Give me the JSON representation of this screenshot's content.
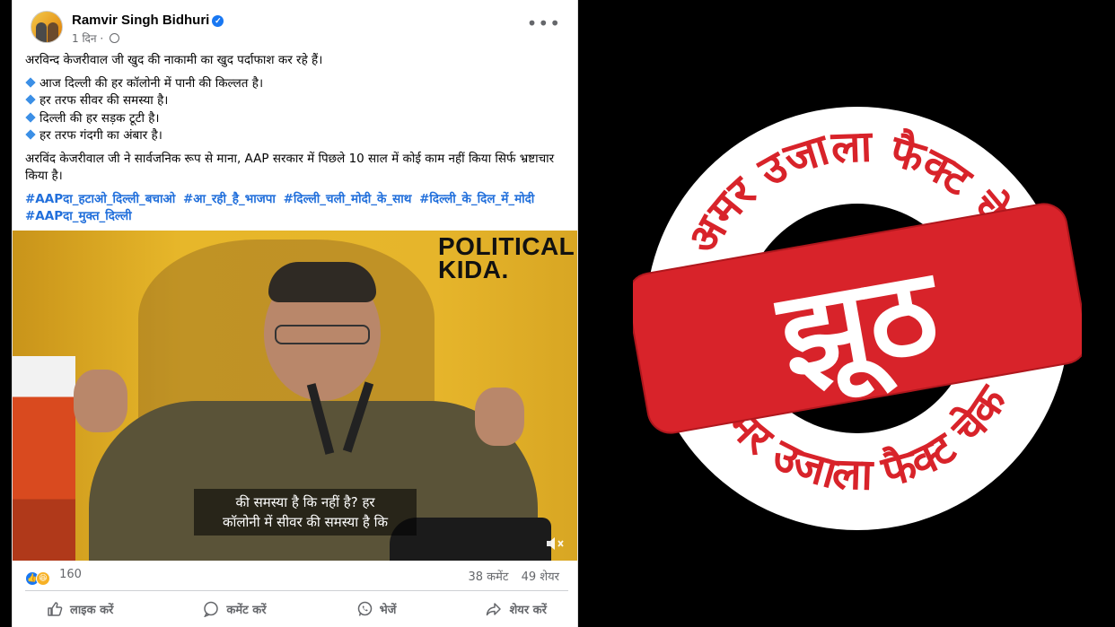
{
  "post": {
    "author": "Ramvir Singh Bidhuri",
    "time": "1 दिन",
    "intro": "अरविन्द केजरीवाल जी खुद की नाकामी का खुद पर्दाफाश कर रहे हैं।",
    "bullets": [
      "आज दिल्ली की हर कॉलोनी में पानी की किल्लत है।",
      "हर तरफ सीवर की समस्या है।",
      "दिल्ली की हर सड़क टूटी है।",
      "हर तरफ गंदगी का अंबार है।"
    ],
    "para": "अरविंद केजरीवाल जी ने सार्वजनिक रूप से माना, AAP सरकार में पिछले 10 साल में कोई काम नहीं किया सिर्फ भ्रष्टाचार किया है।",
    "hashtags": [
      "#AAPदा_हटाओ_दिल्ली_बचाओ",
      "#आ_रही_है_भाजपा",
      "#दिल्ली_चली_मोदी_के_साथ",
      "#दिल्ली_के_दिल_में_मोदी",
      "#AAPदा_मुक्त_दिल्ली"
    ]
  },
  "video": {
    "brand_line1": "POLITICAL",
    "brand_line2": "KIDA.",
    "caption_line1": "की समस्या है कि नहीं है? हर",
    "caption_line2": "कॉलोनी में सीवर की समस्या है कि"
  },
  "stats": {
    "reactions": "160",
    "comments": "38 कमेंट",
    "shares": "49 शेयर"
  },
  "actions": {
    "like": "लाइक करें",
    "comment": "कमेंट करें",
    "send": "भेजें",
    "share": "शेयर करें"
  },
  "stamp": {
    "ring_text": "अमर उजाला फैक्ट चेक",
    "verdict": "झूठ",
    "color": "#d8232a"
  }
}
